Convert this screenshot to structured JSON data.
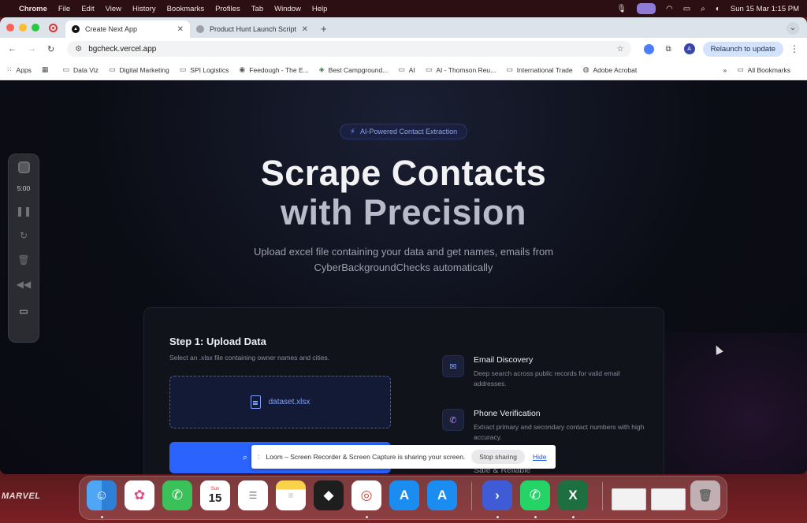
{
  "menubar": {
    "app": "Chrome",
    "menus": [
      "File",
      "Edit",
      "View",
      "History",
      "Bookmarks",
      "Profiles",
      "Tab",
      "Window",
      "Help"
    ],
    "datetime": "Sun 15 Mar  1:15 PM"
  },
  "tabs": [
    {
      "title": "Create Next App",
      "active": true
    },
    {
      "title": "Product Hunt Launch Script",
      "active": false
    }
  ],
  "toolbar": {
    "url": "bgcheck.vercel.app",
    "avatar": "A",
    "relaunch_label": "Relaunch to update"
  },
  "bookmarks": [
    {
      "label": "Apps",
      "icon": "apps-grid-icon"
    },
    {
      "label": "Data Viz",
      "icon": "folder-icon"
    },
    {
      "label": "Digital Marketing",
      "icon": "folder-icon"
    },
    {
      "label": "SPI Logistics",
      "icon": "folder-icon"
    },
    {
      "label": "Feedough - The E...",
      "icon": "site-icon"
    },
    {
      "label": "Best Campground...",
      "icon": "site-icon"
    },
    {
      "label": "AI",
      "icon": "folder-icon"
    },
    {
      "label": "AI - Thomson Reu...",
      "icon": "folder-icon"
    },
    {
      "label": "International Trade",
      "icon": "folder-icon"
    },
    {
      "label": "Adobe Acrobat",
      "icon": "site-icon"
    }
  ],
  "all_bookmarks_label": "All Bookmarks",
  "page": {
    "badge": "AI-Powered Contact Extraction",
    "hero_line1": "Scrape Contacts",
    "hero_line2": "with Precision",
    "subtitle": "Upload excel file containing your data and get names, emails from CyberBackgroundChecks automatically",
    "step_title": "Step 1: Upload Data",
    "step_sub": "Select an .xlsx file containing owner names and cities.",
    "file_name": "dataset.xlsx",
    "features": [
      {
        "title": "Email Discovery",
        "desc": "Deep search across public records for valid email addresses.",
        "icon": "mail-icon"
      },
      {
        "title": "Phone Verification",
        "desc": "Extract primary and secondary contact numbers with high accuracy.",
        "icon": "phone-icon"
      },
      {
        "title": "Safe & Reliable",
        "desc": "",
        "icon": "shield-icon"
      }
    ]
  },
  "loom": {
    "time": "5:00"
  },
  "sharebar": {
    "message": "Loom – Screen Recorder & Screen Capture is sharing your screen.",
    "stop_label": "Stop sharing",
    "hide_label": "Hide"
  },
  "dock": {
    "wallpaper_text": "MARVEL",
    "calendar_day": "Sun",
    "calendar_date": "15"
  },
  "colors": {
    "accent": "#2b63ff",
    "page_bg": "#0b0d15",
    "badge_text": "#8ea4f3"
  }
}
